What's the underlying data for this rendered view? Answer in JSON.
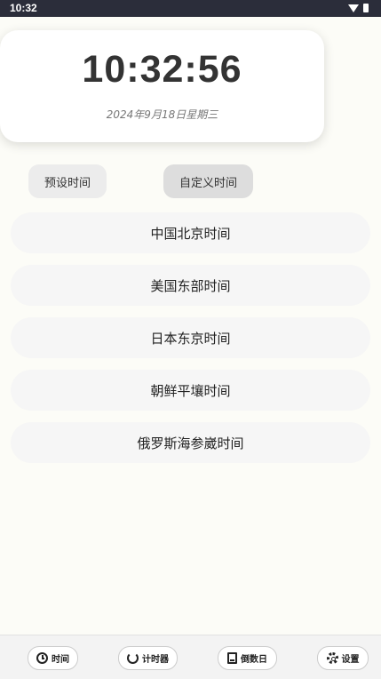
{
  "status_bar": {
    "time": "10:32"
  },
  "clock": {
    "time": "10:32:56",
    "date": "2024年9月18日星期三"
  },
  "mode_tabs": {
    "preset": "预设时间",
    "custom": "自定义时间"
  },
  "time_zones": [
    "中国北京时间",
    "美国东部时间",
    "日本东京时间",
    "朝鲜平壤时间",
    "俄罗斯海参崴时间"
  ],
  "bottom_nav": {
    "time": "时间",
    "timer": "计时器",
    "countdown": "倒数日",
    "settings": "设置"
  }
}
